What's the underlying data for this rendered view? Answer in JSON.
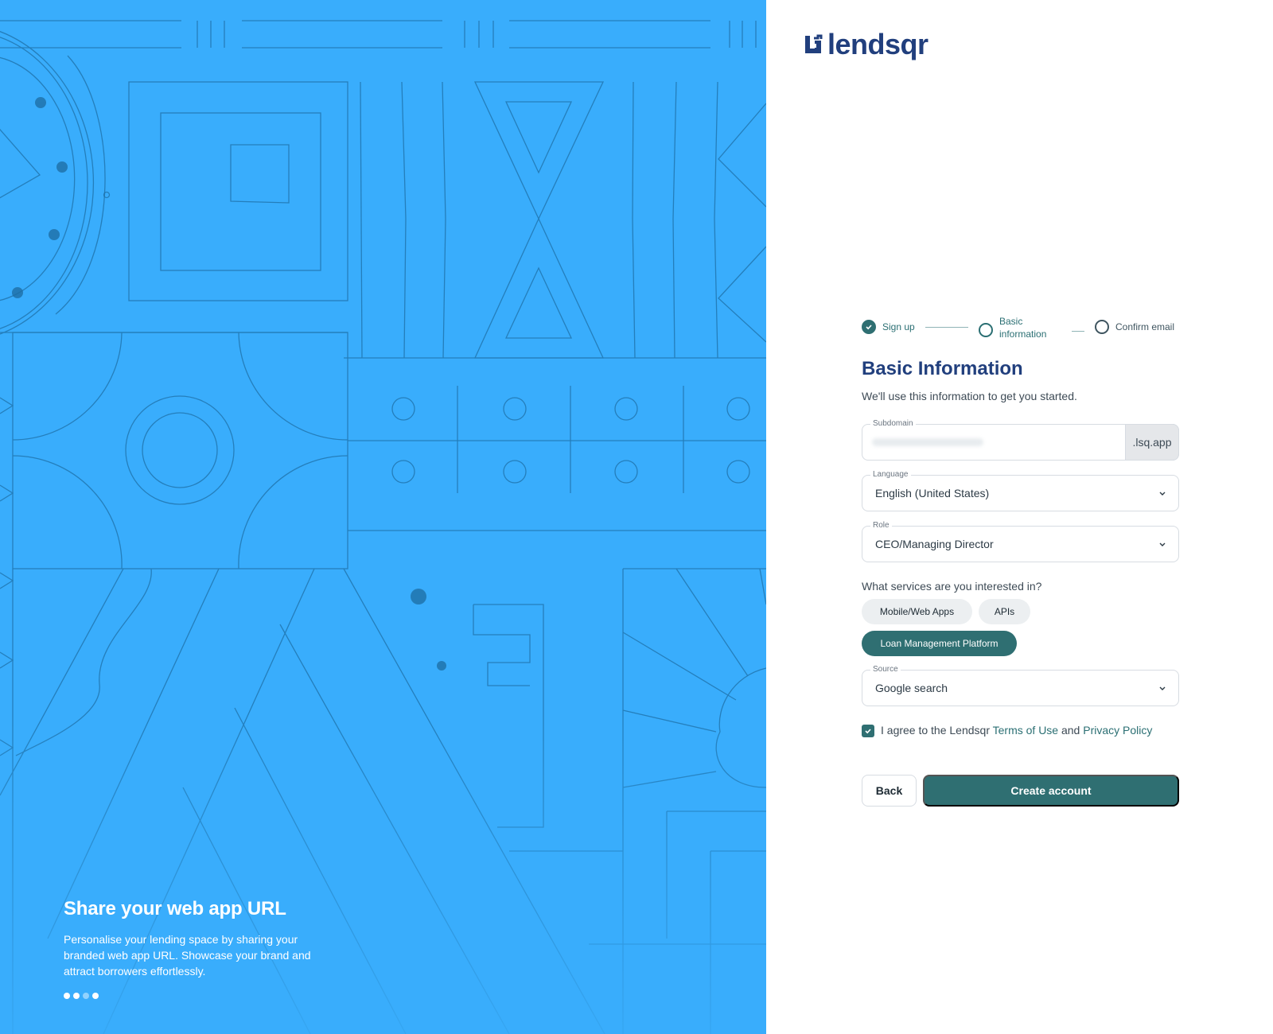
{
  "brand": {
    "name": "lendsqr",
    "logo_icon": "lendsqr-logo-icon"
  },
  "hero": {
    "title": "Share your web app URL",
    "text": "Personalise your lending space by sharing your branded web app URL. Showcase your brand and attract borrowers effortlessly.",
    "slides_total": 4,
    "slide_active": 3
  },
  "stepper": {
    "steps": [
      {
        "label": "Sign up",
        "state": "complete"
      },
      {
        "label": "Basic information",
        "state": "current"
      },
      {
        "label": "Confirm email",
        "state": "pending"
      }
    ]
  },
  "form": {
    "title": "Basic Information",
    "subtitle": "We'll use this information to get you started.",
    "subdomain": {
      "label": "Subdomain",
      "value": "",
      "suffix": ".lsq.app"
    },
    "language": {
      "label": "Language",
      "value": "English (United States)"
    },
    "role": {
      "label": "Role",
      "value": "CEO/Managing Director"
    },
    "services": {
      "question": "What services are you interested in?",
      "options": [
        {
          "label": "Mobile/Web Apps",
          "selected": false
        },
        {
          "label": "APIs",
          "selected": false
        },
        {
          "label": "Loan Management Platform",
          "selected": true
        }
      ]
    },
    "source": {
      "label": "Source",
      "value": "Google search"
    },
    "agreement": {
      "checked": true,
      "prefix": "I agree to the Lendsqr ",
      "terms": "Terms of Use",
      "and": " and ",
      "privacy": "Privacy Policy"
    },
    "back_label": "Back",
    "submit_label": "Create account"
  },
  "colors": {
    "hero_background": "#39adfc",
    "brand_navy": "#213f7d",
    "primary_teal": "#2f6f72"
  }
}
